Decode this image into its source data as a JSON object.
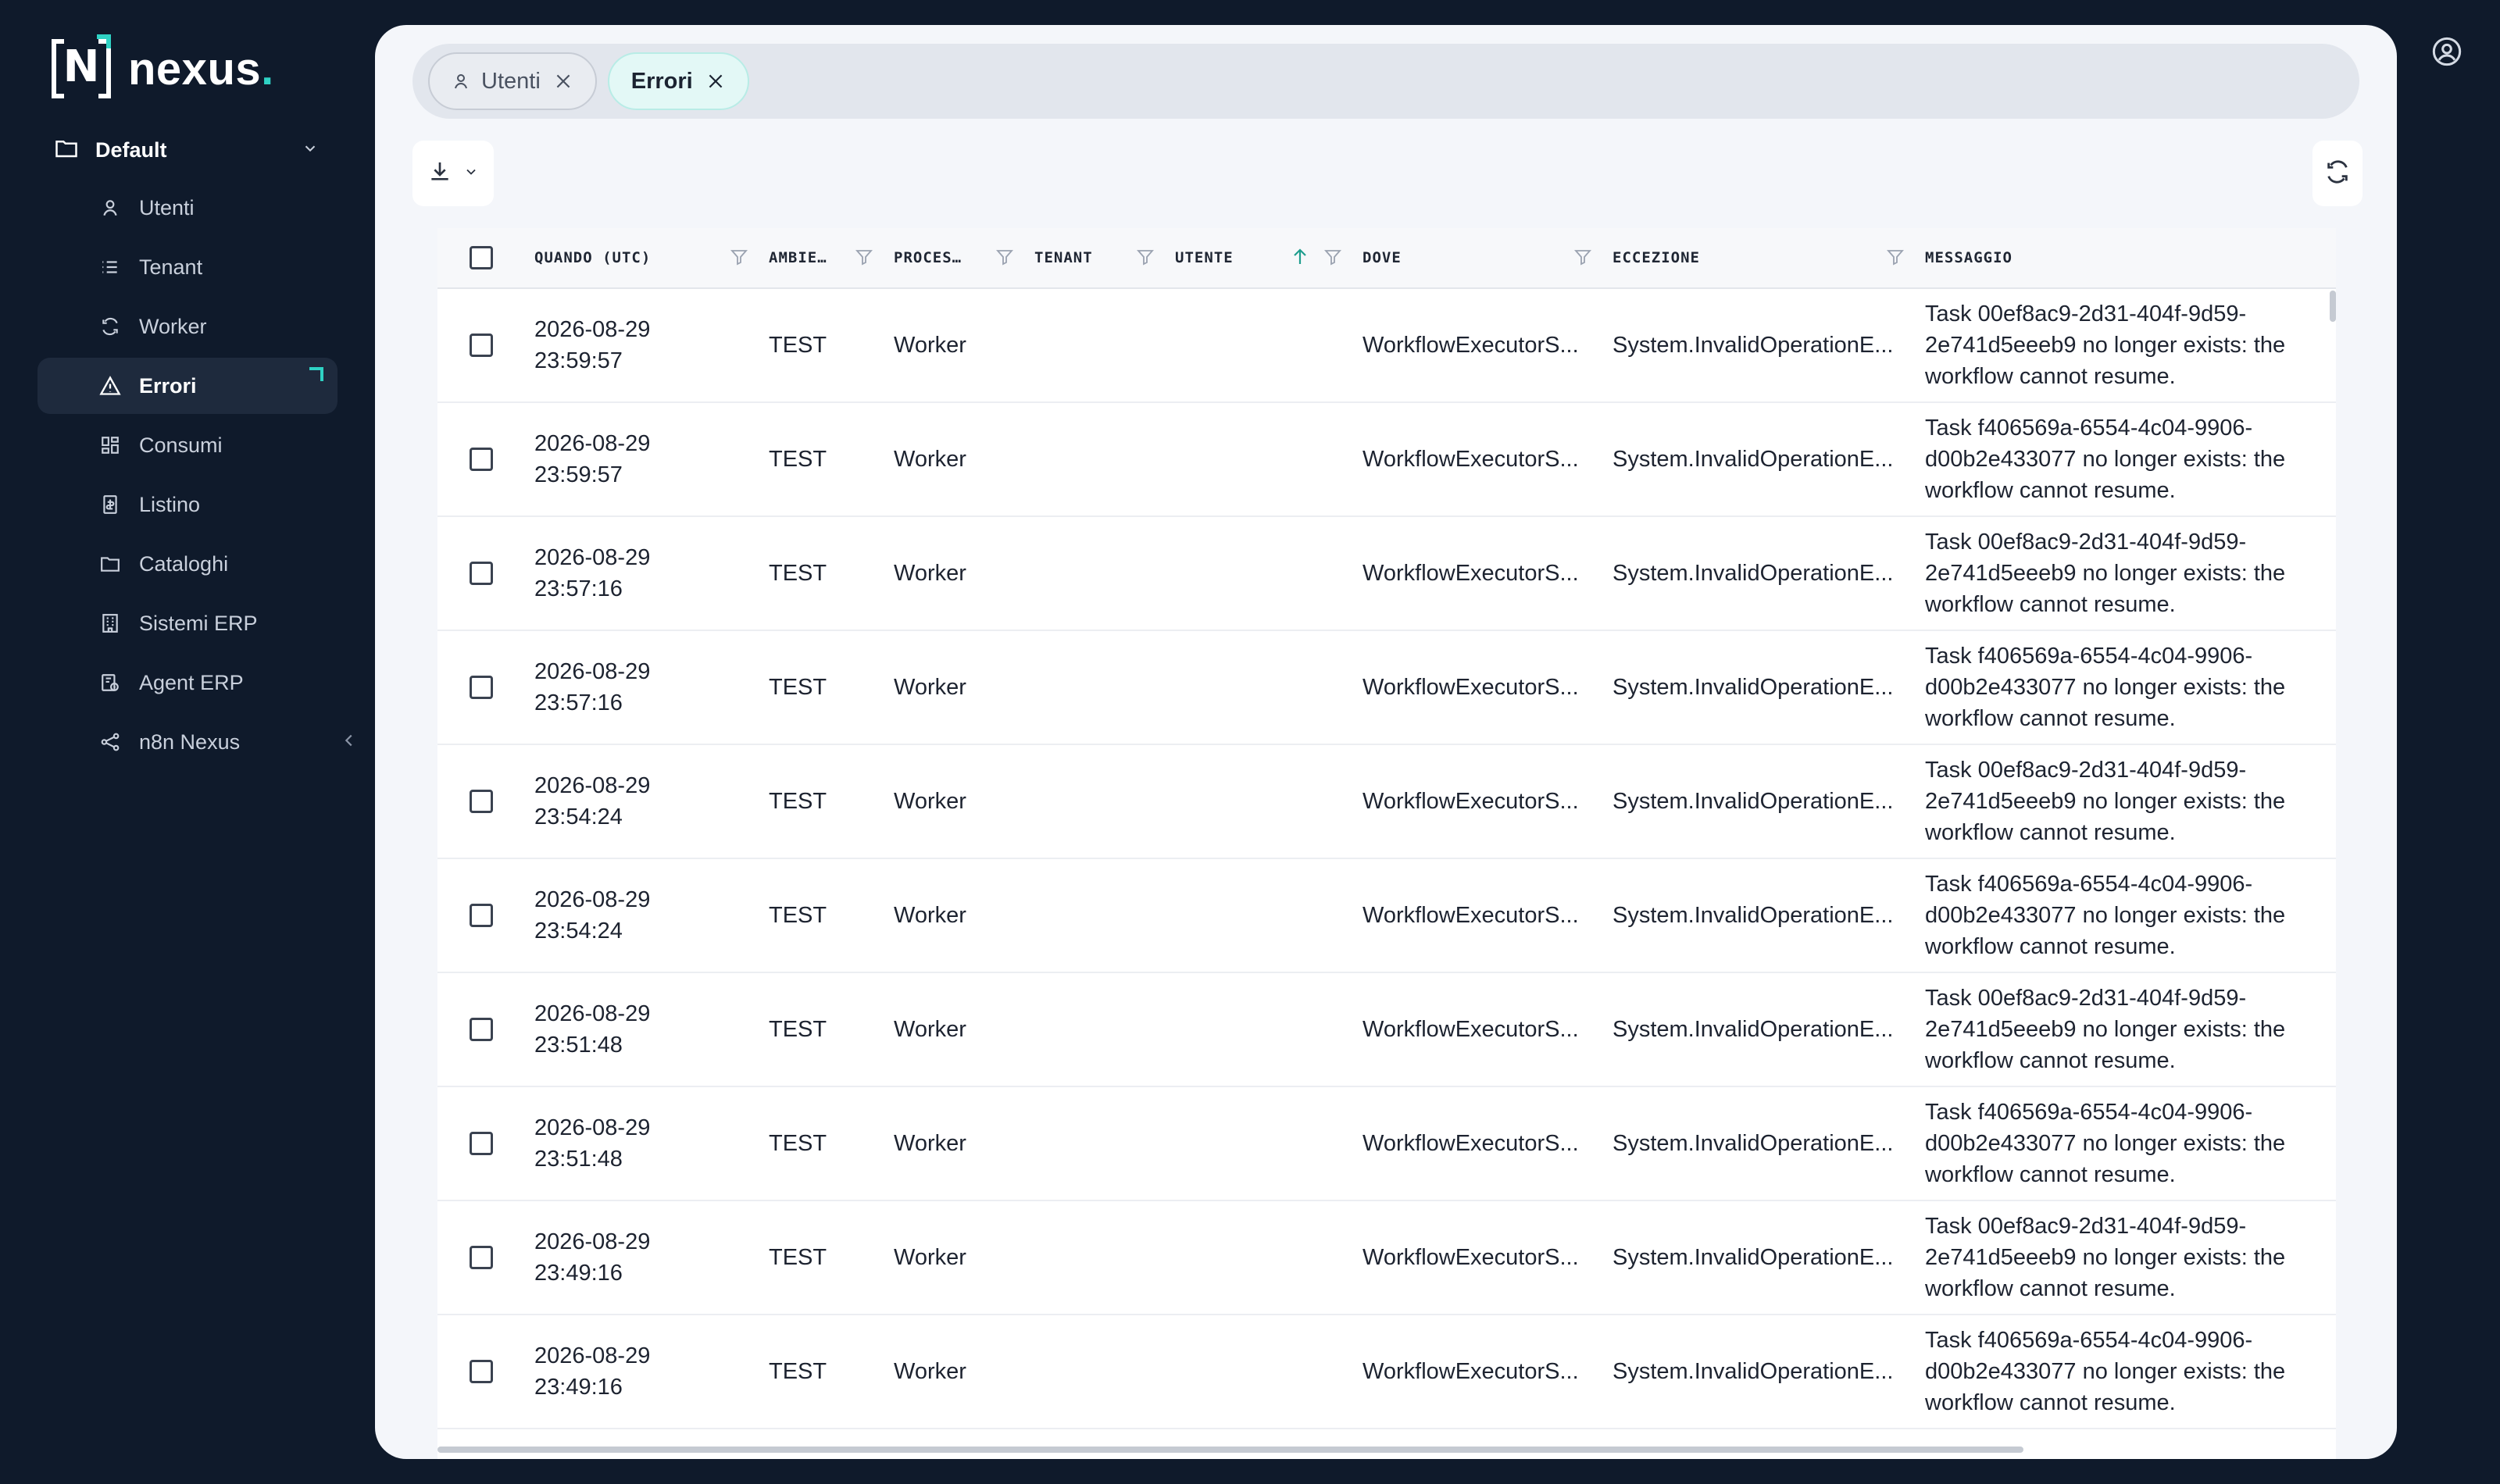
{
  "app": {
    "logo_text": "nexus",
    "logo_dot": ".",
    "logo_letter": "N"
  },
  "sidebar": {
    "folder_label": "Default",
    "items": [
      {
        "label": "Utenti",
        "icon": "user-icon",
        "active": false
      },
      {
        "label": "Tenant",
        "icon": "list-icon",
        "active": false
      },
      {
        "label": "Worker",
        "icon": "refresh-icon",
        "active": false
      },
      {
        "label": "Errori",
        "icon": "warning-icon",
        "active": true
      },
      {
        "label": "Consumi",
        "icon": "dashboard-icon",
        "active": false
      },
      {
        "label": "Listino",
        "icon": "price-list-icon",
        "active": false
      },
      {
        "label": "Cataloghi",
        "icon": "folder-icon",
        "active": false
      },
      {
        "label": "Sistemi ERP",
        "icon": "building-icon",
        "active": false
      },
      {
        "label": "Agent ERP",
        "icon": "agent-icon",
        "active": false
      },
      {
        "label": "n8n Nexus",
        "icon": "share-icon",
        "active": false
      }
    ]
  },
  "tabs": [
    {
      "label": "Utenti",
      "active": false
    },
    {
      "label": "Errori",
      "active": true
    }
  ],
  "table": {
    "columns": [
      "QUANDO (UTC)",
      "AMBIE…",
      "PROCES…",
      "TENANT",
      "UTENTE",
      "DOVE",
      "ECCEZIONE",
      "MESSAGGIO"
    ],
    "rows": [
      {
        "date": "2026-08-29",
        "time": "23:59:57",
        "env": "TEST",
        "proc": "Worker",
        "tenant": "",
        "user": "",
        "where": "WorkflowExecutorS...",
        "exc": "System.InvalidOperationE...",
        "msg": "Task 00ef8ac9-2d31-404f-9d59-2e741d5eeeb9 no longer exists: the workflow cannot resume."
      },
      {
        "date": "2026-08-29",
        "time": "23:59:57",
        "env": "TEST",
        "proc": "Worker",
        "tenant": "",
        "user": "",
        "where": "WorkflowExecutorS...",
        "exc": "System.InvalidOperationE...",
        "msg": "Task f406569a-6554-4c04-9906-d00b2e433077 no longer exists: the workflow cannot resume."
      },
      {
        "date": "2026-08-29",
        "time": "23:57:16",
        "env": "TEST",
        "proc": "Worker",
        "tenant": "",
        "user": "",
        "where": "WorkflowExecutorS...",
        "exc": "System.InvalidOperationE...",
        "msg": "Task 00ef8ac9-2d31-404f-9d59-2e741d5eeeb9 no longer exists: the workflow cannot resume."
      },
      {
        "date": "2026-08-29",
        "time": "23:57:16",
        "env": "TEST",
        "proc": "Worker",
        "tenant": "",
        "user": "",
        "where": "WorkflowExecutorS...",
        "exc": "System.InvalidOperationE...",
        "msg": "Task f406569a-6554-4c04-9906-d00b2e433077 no longer exists: the workflow cannot resume."
      },
      {
        "date": "2026-08-29",
        "time": "23:54:24",
        "env": "TEST",
        "proc": "Worker",
        "tenant": "",
        "user": "",
        "where": "WorkflowExecutorS...",
        "exc": "System.InvalidOperationE...",
        "msg": "Task 00ef8ac9-2d31-404f-9d59-2e741d5eeeb9 no longer exists: the workflow cannot resume."
      },
      {
        "date": "2026-08-29",
        "time": "23:54:24",
        "env": "TEST",
        "proc": "Worker",
        "tenant": "",
        "user": "",
        "where": "WorkflowExecutorS...",
        "exc": "System.InvalidOperationE...",
        "msg": "Task f406569a-6554-4c04-9906-d00b2e433077 no longer exists: the workflow cannot resume."
      },
      {
        "date": "2026-08-29",
        "time": "23:51:48",
        "env": "TEST",
        "proc": "Worker",
        "tenant": "",
        "user": "",
        "where": "WorkflowExecutorS...",
        "exc": "System.InvalidOperationE...",
        "msg": "Task 00ef8ac9-2d31-404f-9d59-2e741d5eeeb9 no longer exists: the workflow cannot resume."
      },
      {
        "date": "2026-08-29",
        "time": "23:51:48",
        "env": "TEST",
        "proc": "Worker",
        "tenant": "",
        "user": "",
        "where": "WorkflowExecutorS...",
        "exc": "System.InvalidOperationE...",
        "msg": "Task f406569a-6554-4c04-9906-d00b2e433077 no longer exists: the workflow cannot resume."
      },
      {
        "date": "2026-08-29",
        "time": "23:49:16",
        "env": "TEST",
        "proc": "Worker",
        "tenant": "",
        "user": "",
        "where": "WorkflowExecutorS...",
        "exc": "System.InvalidOperationE...",
        "msg": "Task 00ef8ac9-2d31-404f-9d59-2e741d5eeeb9 no longer exists: the workflow cannot resume."
      },
      {
        "date": "2026-08-29",
        "time": "23:49:16",
        "env": "TEST",
        "proc": "Worker",
        "tenant": "",
        "user": "",
        "where": "WorkflowExecutorS...",
        "exc": "System.InvalidOperationE...",
        "msg": "Task f406569a-6554-4c04-9906-d00b2e433077 no longer exists: the workflow cannot resume."
      }
    ]
  },
  "colors": {
    "accent": "#2fd2c4",
    "sidebar_bg": "#0f1a2b",
    "sort_arrow": "#1f9e8e"
  }
}
